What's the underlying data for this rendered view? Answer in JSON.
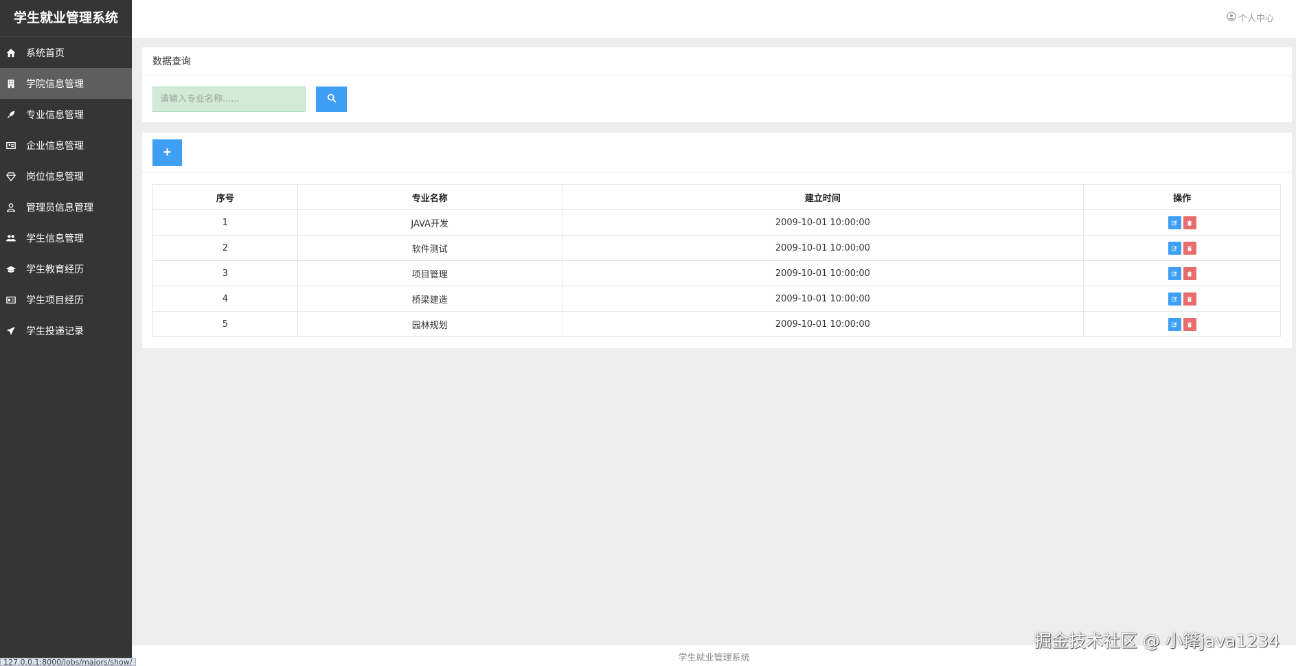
{
  "app": {
    "title": "学生就业管理系统"
  },
  "sidebar": {
    "items": [
      {
        "label": "系统首页",
        "icon": "home-icon"
      },
      {
        "label": "学院信息管理",
        "icon": "building-icon",
        "active": true
      },
      {
        "label": "专业信息管理",
        "icon": "rocket-icon"
      },
      {
        "label": "企业信息管理",
        "icon": "id-card-icon"
      },
      {
        "label": "岗位信息管理",
        "icon": "diamond-icon"
      },
      {
        "label": "管理员信息管理",
        "icon": "user-icon"
      },
      {
        "label": "学生信息管理",
        "icon": "users-icon"
      },
      {
        "label": "学生教育经历",
        "icon": "graduation-cap-icon"
      },
      {
        "label": "学生项目经历",
        "icon": "address-card-icon"
      },
      {
        "label": "学生投递记录",
        "icon": "paper-plane-icon"
      }
    ]
  },
  "header": {
    "user_center": "个人中心"
  },
  "search": {
    "panel_title": "数据查询",
    "placeholder": "请输入专业名称......"
  },
  "table": {
    "add_label": "+",
    "columns": [
      "序号",
      "专业名称",
      "建立时间",
      "操作"
    ],
    "rows": [
      {
        "index": "1",
        "name": "JAVA开发",
        "created": "2009-10-01 10:00:00"
      },
      {
        "index": "2",
        "name": "软件测试",
        "created": "2009-10-01 10:00:00"
      },
      {
        "index": "3",
        "name": "项目管理",
        "created": "2009-10-01 10:00:00"
      },
      {
        "index": "4",
        "name": "桥梁建造",
        "created": "2009-10-01 10:00:00"
      },
      {
        "index": "5",
        "name": "园林规划",
        "created": "2009-10-01 10:00:00"
      }
    ]
  },
  "footer": {
    "text": "学生就业管理系统"
  },
  "status_url": "127.0.0.1:8000/jobs/majors/show/",
  "watermark": "掘金技术社区 @ 小箨java1234",
  "colors": {
    "sidebar_bg": "#353535",
    "sidebar_active": "#5e5e5e",
    "primary_button": "#3f9ff5",
    "danger_button": "#e86c6c",
    "search_input_bg": "#d2ead7"
  }
}
